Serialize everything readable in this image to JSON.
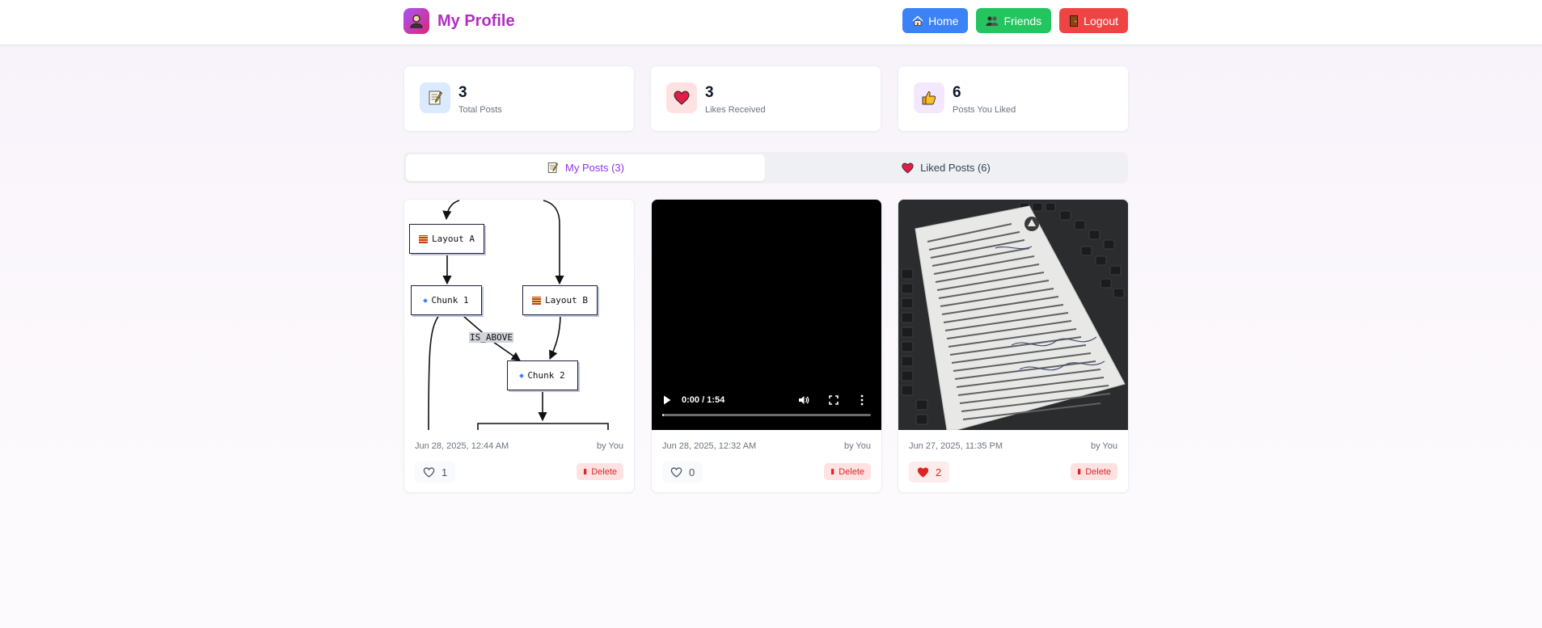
{
  "header": {
    "title": "My Profile",
    "nav": {
      "home_label": "Home",
      "friends_label": "Friends",
      "logout_label": "Logout"
    }
  },
  "stats": [
    {
      "value": "3",
      "label": "Total Posts",
      "icon": "memo-icon",
      "icon_bg": "#dbeafe"
    },
    {
      "value": "3",
      "label": "Likes Received",
      "icon": "heart-icon",
      "icon_bg": "#fee2e2"
    },
    {
      "value": "6",
      "label": "Posts You Liked",
      "icon": "thumbs-up-icon",
      "icon_bg": "#f3e8ff"
    }
  ],
  "tabs": {
    "my_posts_label": "My Posts (3)",
    "liked_posts_label": "Liked Posts (6)"
  },
  "posts": [
    {
      "date": "Jun 28, 2025, 12:44 AM",
      "author": "by You",
      "likes": "1",
      "delete_label": "Delete",
      "media_type": "diagram",
      "diagram": {
        "nodes": [
          "Layout A",
          "Chunk 1",
          "Layout B",
          "Chunk 2"
        ],
        "edge_label": "IS_ABOVE"
      }
    },
    {
      "date": "Jun 28, 2025, 12:32 AM",
      "author": "by You",
      "likes": "0",
      "delete_label": "Delete",
      "media_type": "video",
      "video": {
        "time": "0:00 / 1:54"
      }
    },
    {
      "date": "Jun 27, 2025, 11:35 PM",
      "author": "by You",
      "likes": "2",
      "delete_label": "Delete",
      "media_type": "photo",
      "liked": true
    }
  ],
  "colors": {
    "brand": "#b02fbf",
    "accent": "#9333ea",
    "home": "#3b82f6",
    "friends": "#22c55e",
    "logout": "#ef4444"
  }
}
